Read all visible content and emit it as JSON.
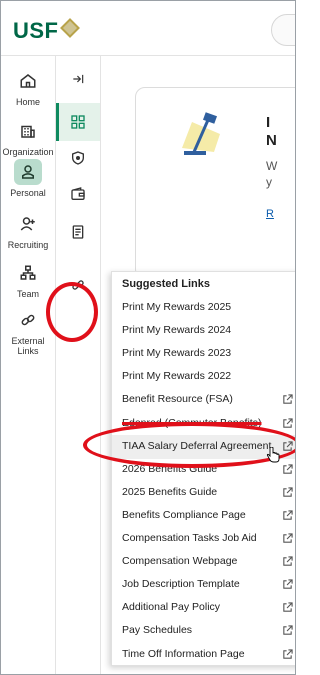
{
  "header": {
    "logo_text": "USF"
  },
  "leftnav": {
    "items": [
      {
        "label": "Home",
        "icon": "home-icon"
      },
      {
        "label": "Organization",
        "icon": "organization-icon"
      },
      {
        "label": "Personal",
        "icon": "person-icon",
        "active": true
      },
      {
        "label": "Recruiting",
        "icon": "recruiting-icon"
      },
      {
        "label": "Team",
        "icon": "team-icon"
      },
      {
        "label": "External\nLinks",
        "label_line1": "External",
        "label_line2": "Links",
        "icon": "link-icon"
      }
    ]
  },
  "rail": {
    "items": [
      {
        "icon": "collapse-arrow-icon"
      },
      {
        "icon": "grid-icon",
        "active": true
      },
      {
        "icon": "shield-icon"
      },
      {
        "icon": "wallet-icon"
      },
      {
        "icon": "document-icon"
      },
      {
        "icon": "link-icon"
      }
    ]
  },
  "card": {
    "title_line1": "I",
    "title_line2": "N",
    "text_line1": "W",
    "text_line2": "y",
    "link": "R"
  },
  "dropdown": {
    "title": "Suggested Links",
    "items": [
      {
        "label": "Print My Rewards 2025",
        "external": false
      },
      {
        "label": "Print My Rewards 2024",
        "external": false
      },
      {
        "label": "Print My Rewards 2023",
        "external": false
      },
      {
        "label": "Print My Rewards 2022",
        "external": false
      },
      {
        "label": "Benefit Resource (FSA)",
        "external": true
      },
      {
        "label": "Edenred (Commuter Benefits)",
        "external": true
      },
      {
        "label": "TIAA Salary Deferral Agreement",
        "external": true,
        "highlighted": true
      },
      {
        "label": "2026 Benefits Guide",
        "external": true
      },
      {
        "label": "2025 Benefits Guide",
        "external": true
      },
      {
        "label": "Benefits Compliance Page",
        "external": true
      },
      {
        "label": "Compensation Tasks Job Aid",
        "external": true
      },
      {
        "label": "Compensation Webpage",
        "external": true
      },
      {
        "label": "Job Description Template",
        "external": true
      },
      {
        "label": "Additional Pay Policy",
        "external": true
      },
      {
        "label": "Pay Schedules",
        "external": true
      },
      {
        "label": "Time Off Information Page",
        "external": true
      }
    ]
  },
  "colors": {
    "brand": "#006747",
    "accent": "#0e8a5f",
    "active_bg": "#b9dccd",
    "annotation": "#e0101a"
  }
}
